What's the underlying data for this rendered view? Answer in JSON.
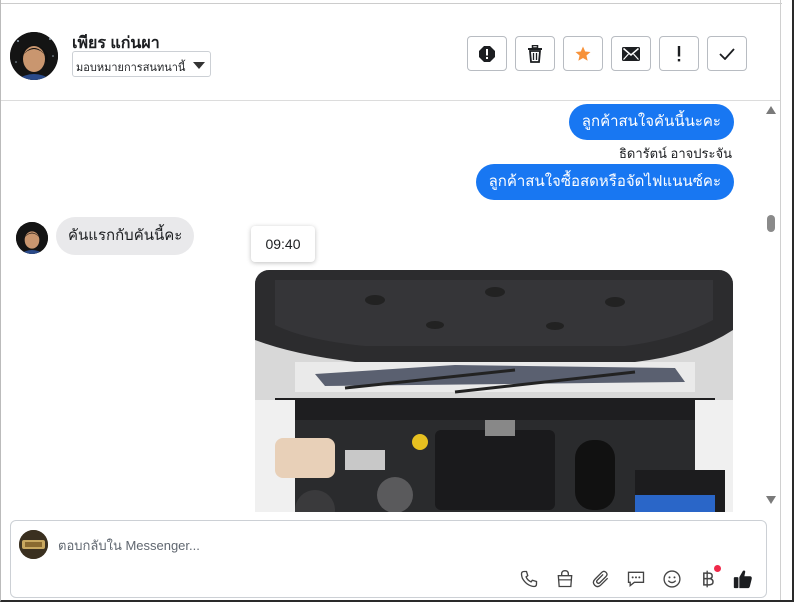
{
  "header": {
    "contact_name": "เพียร แก่นผา",
    "assign_label": "มอบหมายการสนทนานี้",
    "actions": [
      {
        "icon": "exclamation-circle-icon",
        "name": "mark-spam-button"
      },
      {
        "icon": "trash-icon",
        "name": "delete-button"
      },
      {
        "icon": "star-icon",
        "name": "star-button"
      },
      {
        "icon": "envelope-icon",
        "name": "mark-unread-button"
      },
      {
        "icon": "exclamation-icon",
        "name": "follow-up-button"
      },
      {
        "icon": "check-icon",
        "name": "mark-done-button"
      }
    ]
  },
  "messages": {
    "out_1": "ลูกค้าสนใจคันนี้นะคะ",
    "sender_name": "ธิดารัตน์ อาจประจัน",
    "out_2": "ลูกค้าสนใจซื้อสดหรือจัดไฟแนนซ์คะ",
    "in_1": "คันแรกกับคันนี้คะ",
    "timestamp_tooltip": "09:40",
    "photo_alt": "engine-bay-photo"
  },
  "composer": {
    "placeholder": "ตอบกลับใน Messenger...",
    "tools": [
      "phone-icon",
      "shopping-bag-icon",
      "paperclip-icon",
      "saved-reply-icon",
      "emoji-icon",
      "baht-payment-icon",
      "thumbs-up-icon"
    ]
  },
  "colors": {
    "accent": "#1877f2",
    "star": "#f7923a",
    "notify": "#f02849",
    "incoming_bubble": "#e9e9eb"
  }
}
